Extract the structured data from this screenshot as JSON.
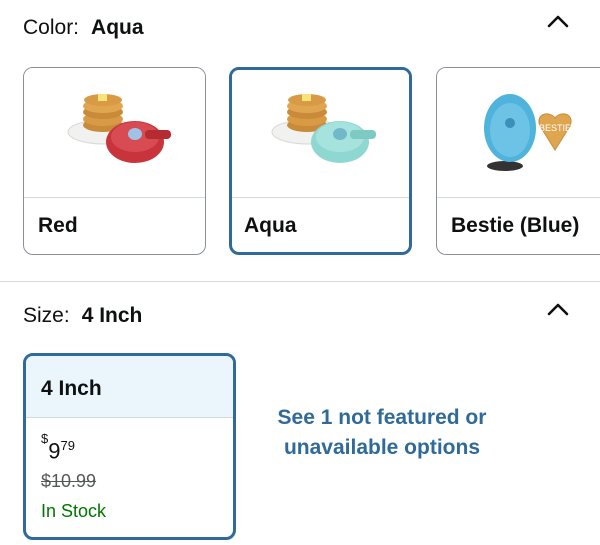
{
  "color_section": {
    "label": "Color:",
    "value": "Aqua",
    "options": [
      {
        "name": "Red",
        "selected": false,
        "accent": "#c9343c"
      },
      {
        "name": "Aqua",
        "selected": true,
        "accent": "#8fd8d2"
      },
      {
        "name": "Bestie (Blue)",
        "selected": false,
        "accent": "#4fb3dc"
      }
    ],
    "bestie_badge_text": "BESTIE"
  },
  "size_section": {
    "label": "Size:",
    "value": "4 Inch",
    "option": {
      "name": "4 Inch",
      "price_symbol": "$",
      "price_whole": "9",
      "price_fraction": "79",
      "list_price": "$10.99",
      "availability": "In Stock"
    },
    "see_more": "See 1 not featured or unavailable options"
  },
  "colors": {
    "selected_border": "#2f6a9a",
    "link": "#2f6a9a",
    "in_stock": "#007600",
    "size_header_bg": "#eaf6fc"
  }
}
